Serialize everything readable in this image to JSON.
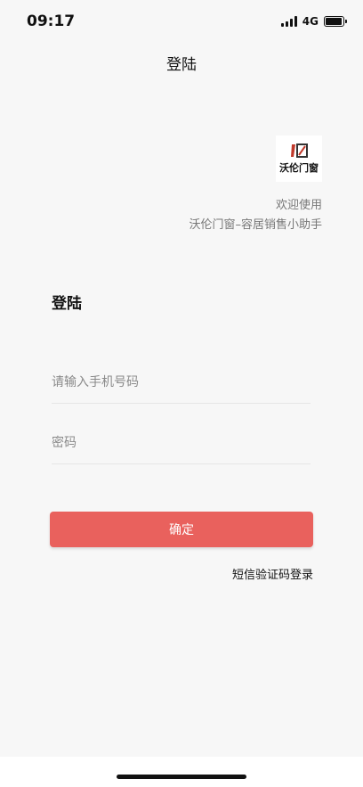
{
  "status_bar": {
    "time": "09:17",
    "network": "4G",
    "icons": [
      "signal-icon",
      "battery-icon"
    ]
  },
  "nav": {
    "title": "登陆"
  },
  "brand": {
    "logo_text": "沃伦门窗",
    "welcome_line1": "欢迎使用",
    "welcome_line2": "沃伦门窗–容居销售小助手"
  },
  "form": {
    "title": "登陆",
    "phone_placeholder": "请输入手机号码",
    "password_placeholder": "密码",
    "confirm_label": "确定",
    "sms_login_label": "短信验证码登录"
  },
  "colors": {
    "accent": "#e9615d",
    "background": "#f7f7f7",
    "logo_red": "#c0392b"
  }
}
